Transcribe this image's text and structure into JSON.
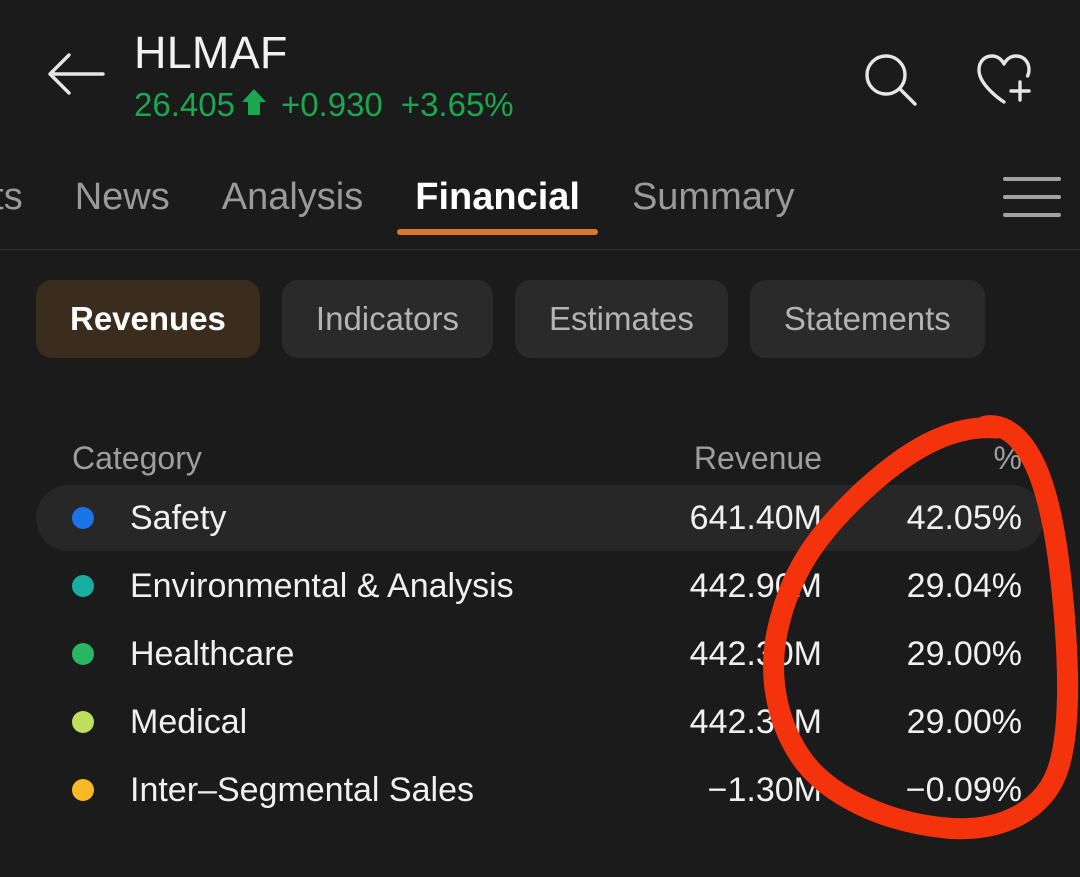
{
  "header": {
    "back_icon": "arrow-left-icon",
    "ticker": "HLMAF",
    "price": "26.405",
    "trend_arrow": "↑",
    "change": "+0.930",
    "change_pct": "+3.65%",
    "positive_color": "#19a750",
    "search_icon": "search-icon",
    "watchlist_icon": "heart-plus-icon"
  },
  "tabs": {
    "items": [
      {
        "label": "nts",
        "active": false,
        "clipped": true
      },
      {
        "label": "News",
        "active": false,
        "clipped": false
      },
      {
        "label": "Analysis",
        "active": false,
        "clipped": false
      },
      {
        "label": "Financial",
        "active": true,
        "clipped": false
      },
      {
        "label": "Summary",
        "active": false,
        "clipped": false
      }
    ],
    "menu_icon": "hamburger-menu-icon",
    "active_underline_color": "#d9782b"
  },
  "subtabs": {
    "items": [
      {
        "label": "Revenues",
        "active": true
      },
      {
        "label": "Indicators",
        "active": false
      },
      {
        "label": "Estimates",
        "active": false
      },
      {
        "label": "Statements",
        "active": false
      }
    ],
    "active_bg": "#3a2d1d"
  },
  "table": {
    "columns": [
      "Category",
      "Revenue",
      "%"
    ],
    "rows": [
      {
        "dot": "#1a73e8",
        "category": "Safety",
        "revenue": "641.40M",
        "percent": "42.05%",
        "highlight": true
      },
      {
        "dot": "#17b0a0",
        "category": "Environmental & Analysis",
        "revenue": "442.90M",
        "percent": "29.04%",
        "highlight": false
      },
      {
        "dot": "#27b763",
        "category": "Healthcare",
        "revenue": "442.30M",
        "percent": "29.00%",
        "highlight": false
      },
      {
        "dot": "#bede5e",
        "category": "Medical",
        "revenue": "442.30M",
        "percent": "29.00%",
        "highlight": false
      },
      {
        "dot": "#f7b924",
        "category": "Inter–Segmental Sales",
        "revenue": "−1.30M",
        "percent": "−0.09%",
        "highlight": false
      }
    ]
  },
  "annotation": {
    "type": "hand-drawn-circle",
    "color": "#f4330c",
    "target": "percent-column"
  }
}
